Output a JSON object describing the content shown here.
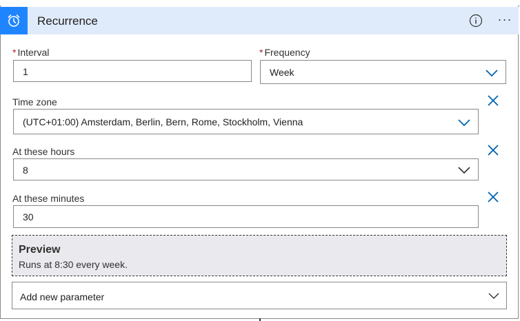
{
  "header": {
    "title": "Recurrence",
    "icon": "alarm-clock-icon",
    "accent": "#1f85ff",
    "background": "#dfebfb"
  },
  "interval": {
    "label": "Interval",
    "required_mark": "*",
    "value": "1"
  },
  "frequency": {
    "label": "Frequency",
    "required_mark": "*",
    "value": "Week"
  },
  "time_zone": {
    "label": "Time zone",
    "value": "(UTC+01:00) Amsterdam, Berlin, Bern, Rome, Stockholm, Vienna"
  },
  "hours": {
    "label": "At these hours",
    "value": "8"
  },
  "minutes": {
    "label": "At these minutes",
    "value": "30"
  },
  "preview": {
    "title": "Preview",
    "text": "Runs at 8:30 every week."
  },
  "add_parameter": {
    "placeholder": "Add new parameter"
  },
  "colors": {
    "link_blue": "#0063b1",
    "required_red": "#a4262c"
  }
}
